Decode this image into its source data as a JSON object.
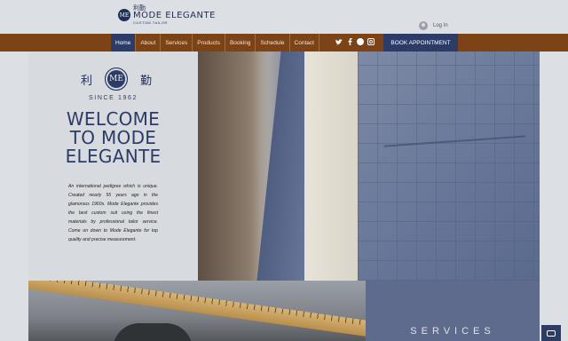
{
  "brand": {
    "chinese": "利勤",
    "name": "MODE ELEGANTE",
    "tagline": "CUSTOM TAILOR",
    "mark": "ME"
  },
  "header": {
    "login_label": "Log In"
  },
  "nav": {
    "items": [
      "Home",
      "About",
      "Services",
      "Products",
      "Booking",
      "Schedule",
      "Contact"
    ],
    "active": "Home",
    "book_label": "BOOK APPOINTMENT",
    "socials": [
      "twitter-icon",
      "facebook-icon",
      "round-icon",
      "instagram-icon"
    ]
  },
  "hero": {
    "char_left": "利",
    "char_right": "勤",
    "badge": "ME",
    "since": "SINCE 1962",
    "welcome_line1": "WELCOME",
    "welcome_line2": "TO MODE",
    "welcome_line3": "ELEGANTE",
    "blurb": "An international pedigree which is unique. Created nearly 55 years ago in the glamorous 1960s. Mode Elegante provides the best custom suit using the finest materials by professional tailor service. Come on down to Mode Elegante for top quality and precise measurement."
  },
  "services": {
    "title": "SERVICES"
  },
  "colors": {
    "nav_bg": "#7b4316",
    "accent": "#2c3c67",
    "services_bg": "#5e6b8c"
  }
}
